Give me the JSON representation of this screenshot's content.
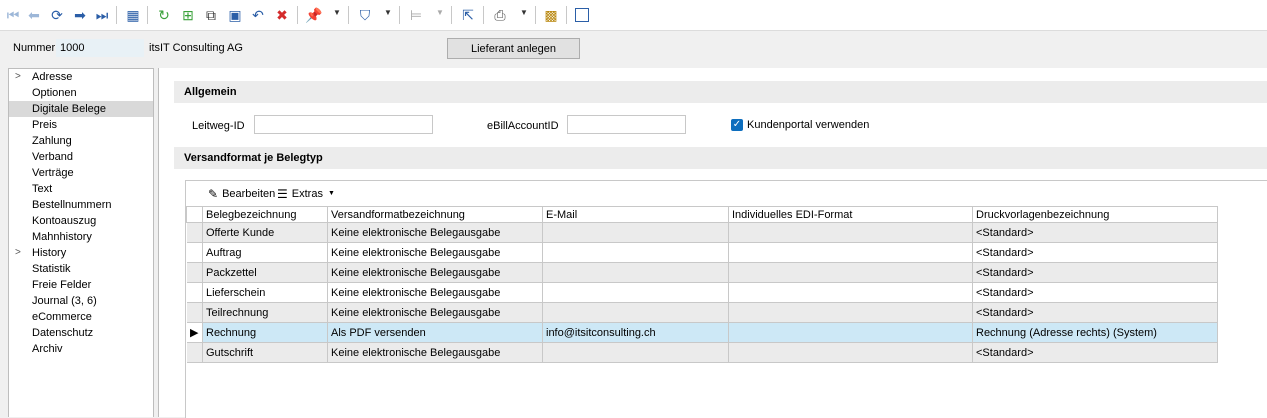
{
  "toolbar": {
    "icons": [
      "first-record-icon",
      "previous-record-icon",
      "refresh-nav-icon",
      "next-record-icon",
      "last-record-icon",
      "table-view-icon",
      "reload-icon",
      "new-record-icon",
      "copy-record-icon",
      "save-icon",
      "undo-icon",
      "delete-icon",
      "pin-icon",
      "filter-icon",
      "tree-icon",
      "select-cursor-icon",
      "print-icon",
      "plugin-icon",
      "save-layout-icon"
    ],
    "colors": {
      "accent": "#2b5ea7",
      "green": "#3aa13a",
      "red": "#d42b2b"
    }
  },
  "header": {
    "nummer_label": "Nummer",
    "nummer_value": "1000",
    "company": "itsIT Consulting AG",
    "lieferant_button": "Lieferant anlegen"
  },
  "sidebar": {
    "items": [
      {
        "label": "Adresse",
        "expandable": true
      },
      {
        "label": "Optionen",
        "expandable": false
      },
      {
        "label": "Digitale Belege",
        "expandable": false,
        "selected": true
      },
      {
        "label": "Preis",
        "expandable": false
      },
      {
        "label": "Zahlung",
        "expandable": false
      },
      {
        "label": "Verband",
        "expandable": false
      },
      {
        "label": "Verträge",
        "expandable": false
      },
      {
        "label": "Text",
        "expandable": false
      },
      {
        "label": "Bestellnummern",
        "expandable": false
      },
      {
        "label": "Kontoauszug",
        "expandable": false
      },
      {
        "label": "Mahnhistory",
        "expandable": false
      },
      {
        "label": "History",
        "expandable": true
      },
      {
        "label": "Statistik",
        "expandable": false
      },
      {
        "label": "Freie Felder",
        "expandable": false
      },
      {
        "label": "Journal (3, 6)",
        "expandable": false
      },
      {
        "label": "eCommerce",
        "expandable": false
      },
      {
        "label": "Datenschutz",
        "expandable": false
      },
      {
        "label": "Archiv",
        "expandable": false
      }
    ]
  },
  "allgemein": {
    "title": "Allgemein",
    "leitweg_label": "Leitweg-ID",
    "leitweg_value": "",
    "ebill_label": "eBillAccountID",
    "ebill_value": "",
    "kundenportal_label": "Kundenportal verwenden",
    "kundenportal_checked": true
  },
  "versand": {
    "title": "Versandformat je Belegtyp",
    "bearbeiten_label": "Bearbeiten",
    "extras_label": "Extras",
    "columns": [
      "Belegbezeichnung",
      "Versandformatbezeichnung",
      "E-Mail",
      "Individuelles EDI-Format",
      "Druckvorlagenbezeichnung"
    ],
    "rows": [
      [
        "Offerte Kunde",
        "Keine elektronische Belegausgabe",
        "",
        "",
        "<Standard>"
      ],
      [
        "Auftrag",
        "Keine elektronische Belegausgabe",
        "",
        "",
        "<Standard>"
      ],
      [
        "Packzettel",
        "Keine elektronische Belegausgabe",
        "",
        "",
        "<Standard>"
      ],
      [
        "Lieferschein",
        "Keine elektronische Belegausgabe",
        "",
        "",
        "<Standard>"
      ],
      [
        "Teilrechnung",
        "Keine elektronische Belegausgabe",
        "",
        "",
        "<Standard>"
      ],
      [
        "Rechnung",
        "Als PDF versenden",
        "info@itsitconsulting.ch",
        "",
        "Rechnung (Adresse rechts) (System)"
      ],
      [
        "Gutschrift",
        "Keine elektronische Belegausgabe",
        "",
        "",
        "<Standard>"
      ]
    ],
    "selected_row": 5
  }
}
